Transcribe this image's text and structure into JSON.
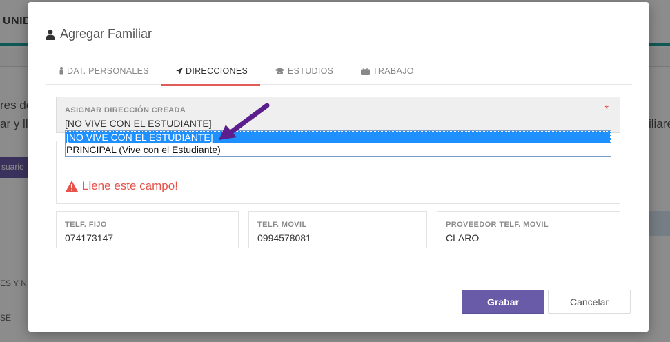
{
  "background": {
    "header_title": "UNID",
    "text_left_1": "res de",
    "text_left_2": "ar y lle",
    "text_right": "iliare",
    "user_button": "suario",
    "label_1": "ES Y N",
    "label_2": "SE"
  },
  "modal": {
    "title": "Agregar Familiar",
    "tabs": [
      {
        "label": "DAT. PERSONALES",
        "icon": "person-icon"
      },
      {
        "label": "DIRECCIONES",
        "icon": "location-arrow-icon"
      },
      {
        "label": "ESTUDIOS",
        "icon": "graduation-cap-icon"
      },
      {
        "label": "TRABAJO",
        "icon": "briefcase-icon"
      }
    ],
    "active_tab": "DIRECCIONES",
    "address_field": {
      "label": "ASIGNAR DIRECCIÓN CREADA",
      "value": "[NO VIVE CON EL ESTUDIANTE]",
      "required_marker": "*",
      "options": [
        "[NO VIVE CON EL ESTUDIANTE]",
        "PRINCIPAL (Vive con el Estudiante)"
      ],
      "selected_index": 0
    },
    "error_message": "Llene este campo!",
    "tel_fijo": {
      "label": "TELF. FIJO",
      "value": "074173147"
    },
    "tel_movil": {
      "label": "TELF. MOVIL",
      "value": "0994578081"
    },
    "proveedor": {
      "label": "PROVEEDOR TELF. MOVIL",
      "value": "CLARO"
    },
    "save_label": "Grabar",
    "cancel_label": "Cancelar"
  },
  "colors": {
    "primary": "#6a5ba8",
    "active_tab_underline": "#e05a56",
    "error": "#e5534b",
    "selected_option": "#1e90ff",
    "arrow": "#5b1e8c"
  }
}
